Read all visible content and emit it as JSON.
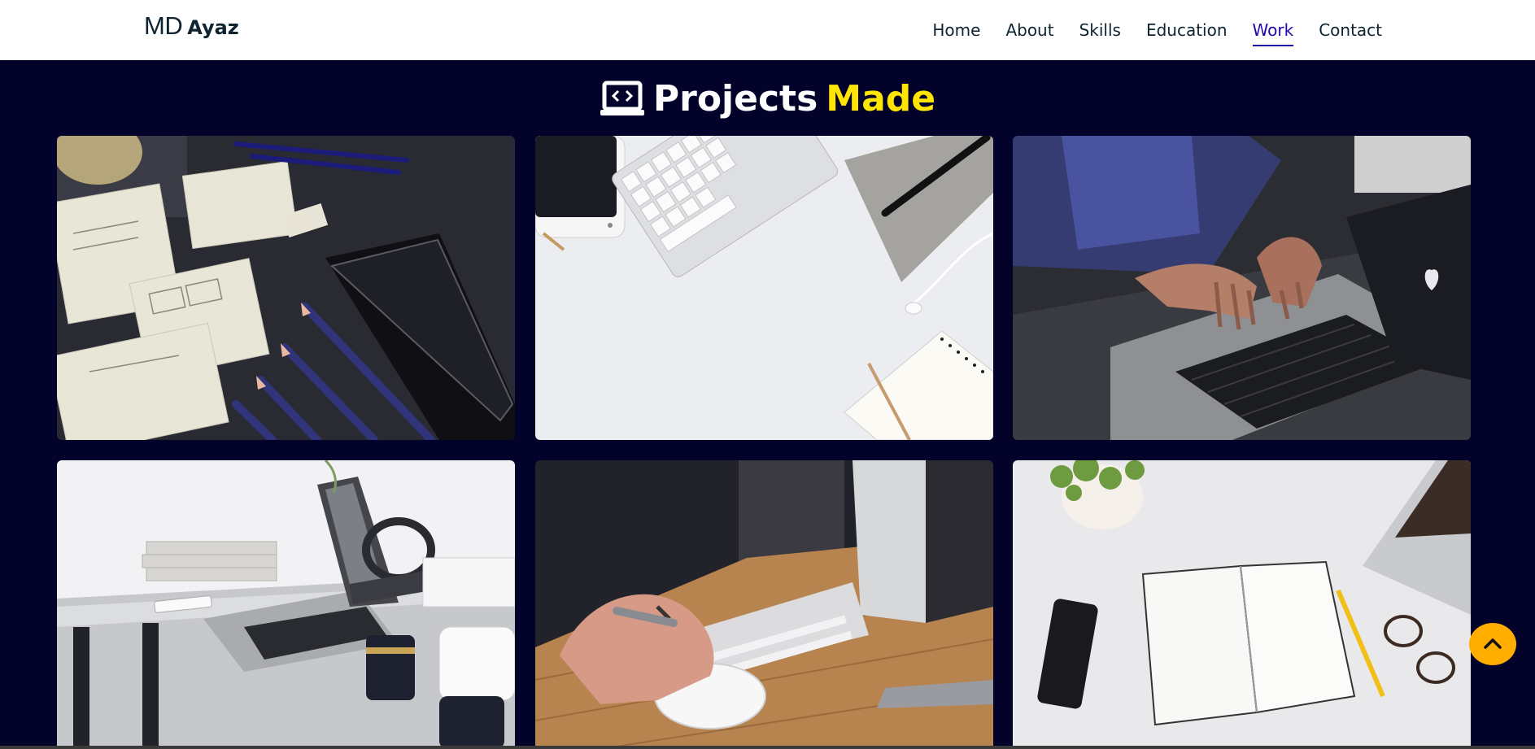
{
  "brand": {
    "initials": "MD",
    "name": "Ayaz"
  },
  "nav": {
    "items": [
      "Home",
      "About",
      "Skills",
      "Education",
      "Work",
      "Contact"
    ],
    "active": "Work"
  },
  "section": {
    "icon": "laptop-code-icon",
    "title_main": "Projects",
    "title_accent": "Made"
  },
  "projects": [
    {
      "image": "wireframe-sketches-desk-photo"
    },
    {
      "image": "keyboard-phone-notebook-flatlay-photo"
    },
    {
      "image": "person-typing-on-laptop-photo"
    },
    {
      "image": "laptop-on-desk-photo"
    },
    {
      "image": "hand-on-mouse-desk-photo"
    },
    {
      "image": "notebook-phone-glasses-flatlay-photo"
    }
  ],
  "scroll_top": {
    "icon": "chevron-up-icon"
  },
  "colors": {
    "page_background": "#02022b",
    "accent_yellow": "#ffe600",
    "active_nav": "#2506ad",
    "scroll_button": "#ffae00"
  }
}
